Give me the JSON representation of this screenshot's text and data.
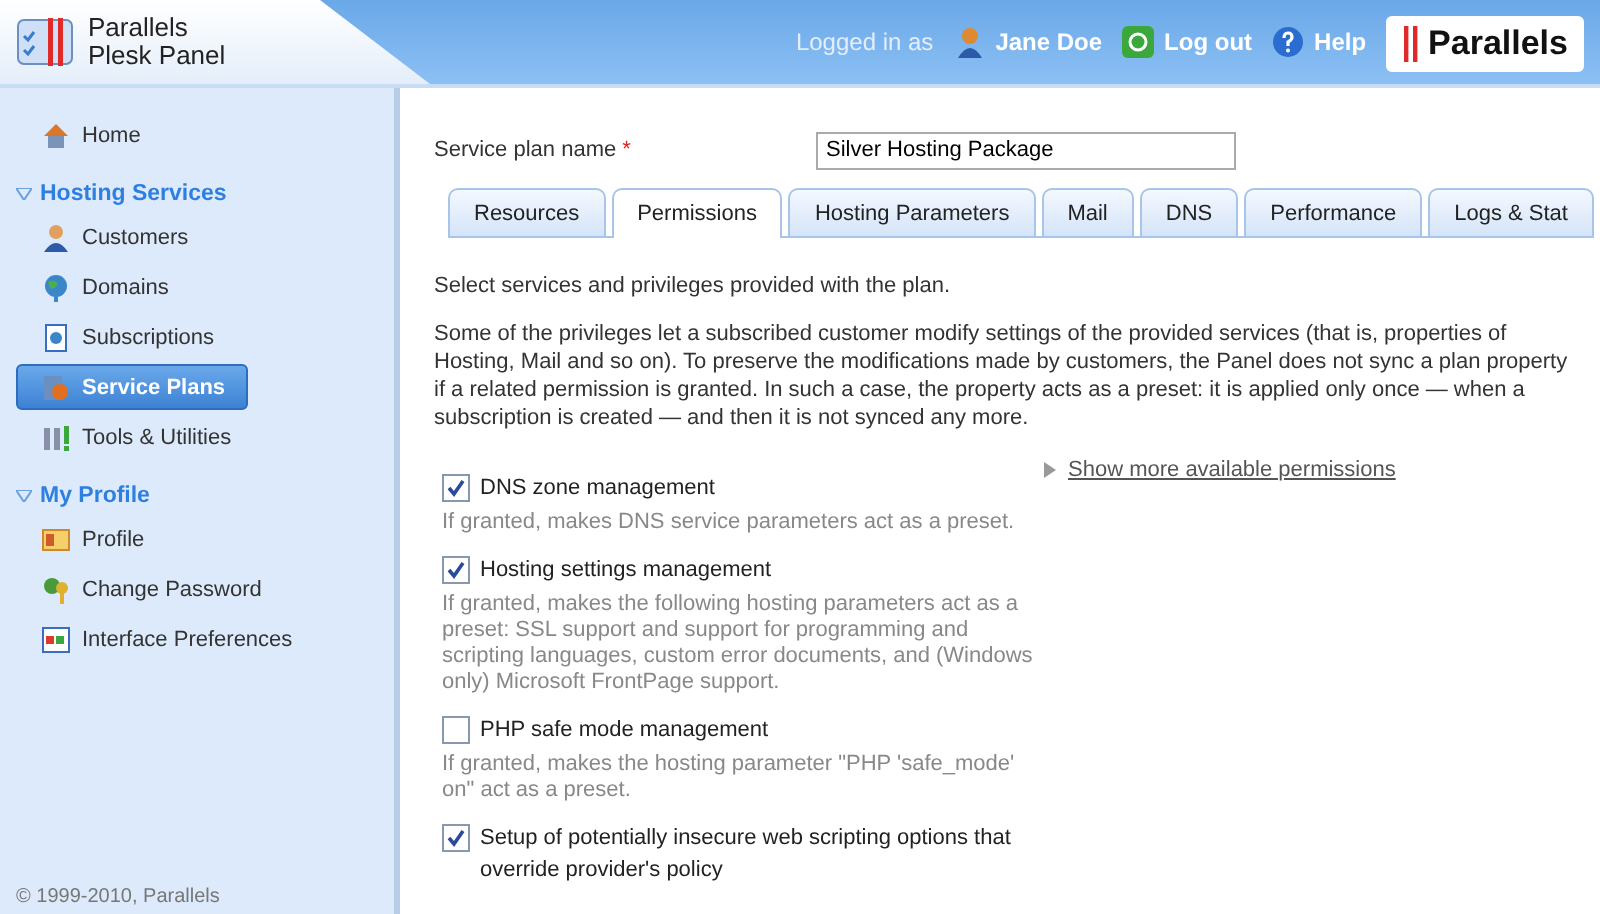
{
  "header": {
    "product_line1": "Parallels",
    "product_line2": "Plesk Panel",
    "logged_in_label": "Logged in as",
    "user": "Jane Doe",
    "logout": "Log out",
    "help": "Help",
    "brand": "Parallels"
  },
  "sidebar": {
    "items": [
      {
        "kind": "link",
        "label": "Home",
        "selected": false
      },
      {
        "kind": "section",
        "label": "Hosting Services",
        "expanded": true
      },
      {
        "kind": "link",
        "label": "Customers",
        "selected": false
      },
      {
        "kind": "link",
        "label": "Domains",
        "selected": false
      },
      {
        "kind": "link",
        "label": "Subscriptions",
        "selected": false
      },
      {
        "kind": "link",
        "label": "Service Plans",
        "selected": true
      },
      {
        "kind": "link",
        "label": "Tools & Utilities",
        "selected": false
      },
      {
        "kind": "section",
        "label": "My Profile",
        "expanded": true
      },
      {
        "kind": "link",
        "label": "Profile",
        "selected": false
      },
      {
        "kind": "link",
        "label": "Change Password",
        "selected": false
      },
      {
        "kind": "link",
        "label": "Interface Preferences",
        "selected": false
      }
    ],
    "footer": "© 1999-2010, Parallels"
  },
  "form": {
    "label": "Service plan name",
    "required_mark": "*",
    "value": "Silver Hosting Package"
  },
  "tabs": [
    {
      "label": "Resources",
      "selected": false
    },
    {
      "label": "Permissions",
      "selected": true
    },
    {
      "label": "Hosting Parameters",
      "selected": false
    },
    {
      "label": "Mail",
      "selected": false
    },
    {
      "label": "DNS",
      "selected": false
    },
    {
      "label": "Performance",
      "selected": false
    },
    {
      "label": "Logs & Stat",
      "selected": false
    }
  ],
  "intro": "Select services and privileges provided with the plan.",
  "description": "Some of the privileges let a subscribed customer modify settings of the provided services (that is, properties of Hosting, Mail and so on). To preserve the modifications made by customers, the Panel does not sync a plan property if a related permission is granted. In such a case, the property acts as a preset: it is applied only once — when a subscription is created — and then it is not synced any more.",
  "permissions": [
    {
      "label": "DNS zone management",
      "checked": true,
      "hint": "If granted, makes DNS service parameters act as a preset."
    },
    {
      "label": "Hosting settings management",
      "checked": true,
      "hint": "If granted, makes the following hosting parameters act as a preset: SSL support and support for programming and scripting languages, custom error documents, and (Windows only) Microsoft FrontPage support."
    },
    {
      "label": "PHP safe mode management",
      "checked": false,
      "hint": "If granted, makes the hosting parameter \"PHP 'safe_mode' on\" act as a preset."
    },
    {
      "label": "Setup of potentially insecure web scripting options that override provider's policy",
      "checked": true
    }
  ],
  "more_link": "Show more available permissions"
}
